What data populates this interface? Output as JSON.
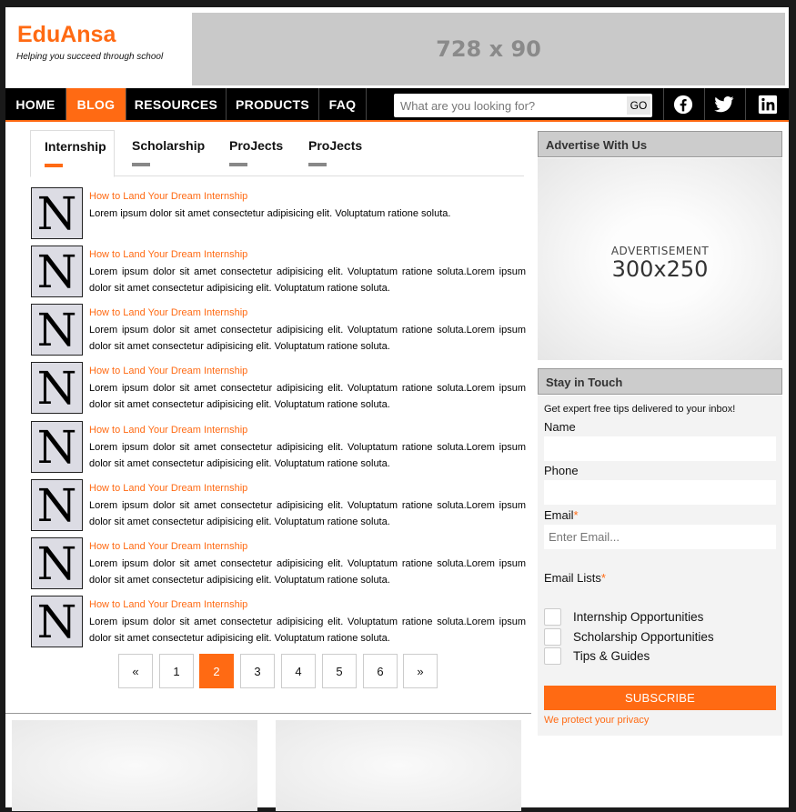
{
  "header": {
    "logo_title": "EduAnsa",
    "tagline": "Helping you succeed through school",
    "banner_text": "728 x 90"
  },
  "nav": {
    "items": [
      {
        "label": "HOME",
        "active": false
      },
      {
        "label": "BLOG",
        "active": true
      },
      {
        "label": "RESOURCES",
        "active": false
      },
      {
        "label": "PRODUCTS",
        "active": false
      },
      {
        "label": "FAQ",
        "active": false
      }
    ],
    "search_placeholder": "What are you looking for?",
    "search_button": "GO",
    "social_icons": [
      "facebook-icon",
      "twitter-icon",
      "linkedin-icon"
    ]
  },
  "tabs": [
    {
      "label": "Internship",
      "active": true
    },
    {
      "label": "Scholarship",
      "active": false
    },
    {
      "label": "ProJects",
      "active": false
    },
    {
      "label": "ProJects",
      "active": false
    }
  ],
  "posts": [
    {
      "thumb_letter": "N",
      "title": "How to Land Your Dream Internship",
      "body": "Lorem ipsum dolor sit amet consectetur adipisicing elit. Voluptatum ratione soluta."
    },
    {
      "thumb_letter": "N",
      "title": "How to Land Your Dream Internship",
      "body": "Lorem ipsum dolor sit amet consectetur adipisicing elit. Voluptatum ratione soluta.Lorem ipsum dolor sit amet consectetur adipisicing elit. Voluptatum ratione soluta."
    },
    {
      "thumb_letter": "N",
      "title": "How to Land Your Dream Internship",
      "body": "Lorem ipsum dolor sit amet consectetur adipisicing elit. Voluptatum ratione soluta.Lorem ipsum dolor sit amet consectetur adipisicing elit. Voluptatum ratione soluta."
    },
    {
      "thumb_letter": "N",
      "title": "How to Land Your Dream Internship",
      "body": "Lorem ipsum dolor sit amet consectetur adipisicing elit. Voluptatum ratione soluta.Lorem ipsum dolor sit amet consectetur adipisicing elit. Voluptatum ratione soluta."
    },
    {
      "thumb_letter": "N",
      "title": "How to Land Your Dream Internship",
      "body": "Lorem ipsum dolor sit amet consectetur adipisicing elit. Voluptatum ratione soluta.Lorem ipsum dolor sit amet consectetur adipisicing elit. Voluptatum ratione soluta."
    },
    {
      "thumb_letter": "N",
      "title": "How to Land Your Dream Internship",
      "body": "Lorem ipsum dolor sit amet consectetur adipisicing elit. Voluptatum ratione soluta.Lorem ipsum dolor sit amet consectetur adipisicing elit. Voluptatum ratione soluta."
    },
    {
      "thumb_letter": "N",
      "title": "How to Land Your Dream Internship",
      "body": "Lorem ipsum dolor sit amet consectetur adipisicing elit. Voluptatum ratione soluta.Lorem ipsum dolor sit amet consectetur adipisicing elit. Voluptatum ratione soluta."
    },
    {
      "thumb_letter": "N",
      "title": "How to Land Your Dream Internship",
      "body": "Lorem ipsum dolor sit amet consectetur adipisicing elit. Voluptatum ratione soluta.Lorem ipsum dolor sit amet consectetur adipisicing elit. Voluptatum ratione soluta."
    }
  ],
  "pagination": {
    "prev": "«",
    "pages": [
      "1",
      "2",
      "3",
      "4",
      "5",
      "6"
    ],
    "current": "2",
    "next": "»"
  },
  "sidebar": {
    "advertise_heading": "Advertise With Us",
    "ad_label": "ADVERTISEMENT",
    "ad_size": "300x250",
    "stay_heading": "Stay in Touch",
    "intro": "Get expert free tips delivered to your inbox!",
    "name_label": "Name",
    "phone_label": "Phone",
    "email_label": "Email",
    "required_mark": "*",
    "email_placeholder": "Enter Email...",
    "lists_label": "Email Lists",
    "lists": [
      "Internship Opportunities",
      "Scholarship Opportunities",
      "Tips & Guides"
    ],
    "subscribe_button": "SUBSCRIBE",
    "privacy_text": "We protect your privacy"
  },
  "colors": {
    "accent": "#ff6a13",
    "nav_bg": "#000000",
    "banner_bg": "#c9c9c9"
  }
}
